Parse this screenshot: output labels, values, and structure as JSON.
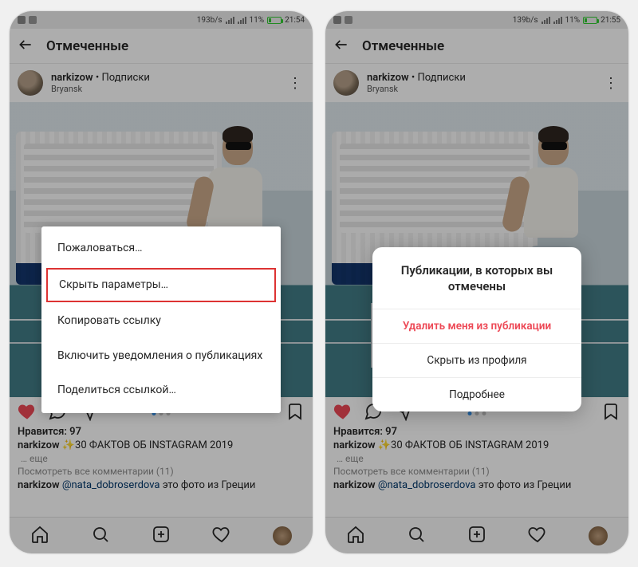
{
  "left": {
    "status": {
      "net": "193b/s",
      "battery_pct": "11%",
      "time": "21:54"
    },
    "header_title": "Отмеченные",
    "post": {
      "username": "narkizow",
      "follow_label": "Подписки",
      "location": "Bryansk",
      "likes_label": "Нравится: 97",
      "caption_user": "narkizow",
      "caption_text": "✨30 ФАКТОВ ОБ INSTAGRAM 2019",
      "more": "… еще",
      "view_all": "Посмотреть все комментарии (11)",
      "comment_user": "narkizow",
      "comment_mention": "@nata_dobroserdova",
      "comment_rest": " это фото из Греции"
    }
  },
  "right": {
    "status": {
      "net": "139b/s",
      "battery_pct": "11%",
      "time": "21:55"
    },
    "header_title": "Отмеченные",
    "post": {
      "username": "narkizow",
      "follow_label": "Подписки",
      "location": "Bryansk",
      "likes_label": "Нравится: 97",
      "caption_user": "narkizow",
      "caption_text": "✨30 ФАКТОВ ОБ INSTAGRAM 2019",
      "more": "… еще",
      "view_all": "Посмотреть все комментарии (11)",
      "comment_user": "narkizow",
      "comment_mention": "@nata_dobroserdova",
      "comment_rest": " это фото из Греции"
    }
  },
  "menu": {
    "report": "Пожаловаться…",
    "hide_params": "Скрыть параметры…",
    "copy_link": "Копировать ссылку",
    "enable_notifs": "Включить уведомления о публикациях",
    "share_link": "Поделиться ссылкой…"
  },
  "dialog": {
    "title": "Публикации, в которых вы отмечены",
    "remove_me": "Удалить меня из публикации",
    "hide_profile": "Скрыть из профиля",
    "more": "Подробнее"
  }
}
